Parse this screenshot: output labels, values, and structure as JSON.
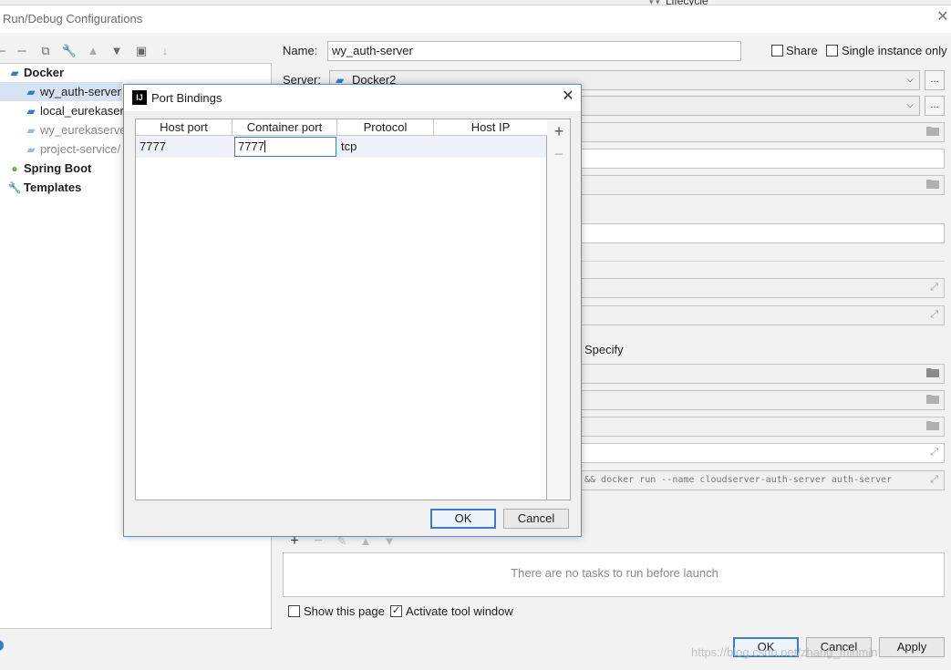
{
  "background": {
    "lifecycle_label": "Lifecycle"
  },
  "window": {
    "title": "Run/Debug Configurations",
    "close_glyph": "✕"
  },
  "tree": {
    "docker_label": "Docker",
    "items": [
      {
        "label": "wy_auth-server",
        "selected": true
      },
      {
        "label": "local_eurekaser"
      },
      {
        "label": "wy_eurekaserve",
        "faded": true
      },
      {
        "label": "project-service/",
        "faded": true
      }
    ],
    "spring_boot_label": "Spring Boot",
    "templates_label": "Templates"
  },
  "form": {
    "name_label": "Name:",
    "name_value": "wy_auth-server",
    "share_label": "Share",
    "single_instance_label": "Single instance only",
    "server_label": "Server:",
    "server_value": "Docker2",
    "specify_label": ") Specify",
    "command_text": "&& docker run --name cloudserver-auth-server auth-server",
    "tasks_empty_text": "There are no tasks to run before launch",
    "show_page_label": "Show this page",
    "activate_tool_window_label": "Activate tool window",
    "browse_glyph": "..."
  },
  "buttons": {
    "ok": "OK",
    "cancel": "Cancel",
    "apply": "Apply"
  },
  "dialog": {
    "title": "Port Bindings",
    "close_glyph": "✕",
    "icon_text": "IJ",
    "columns": [
      "Host port",
      "Container port",
      "Protocol",
      "Host IP"
    ],
    "row": {
      "host_port": "7777",
      "container_port": "7777",
      "protocol": "tcp",
      "host_ip": ""
    },
    "ok": "OK",
    "cancel": "Cancel"
  },
  "watermark": "https://blog.csdn.net/zhang_minmin"
}
